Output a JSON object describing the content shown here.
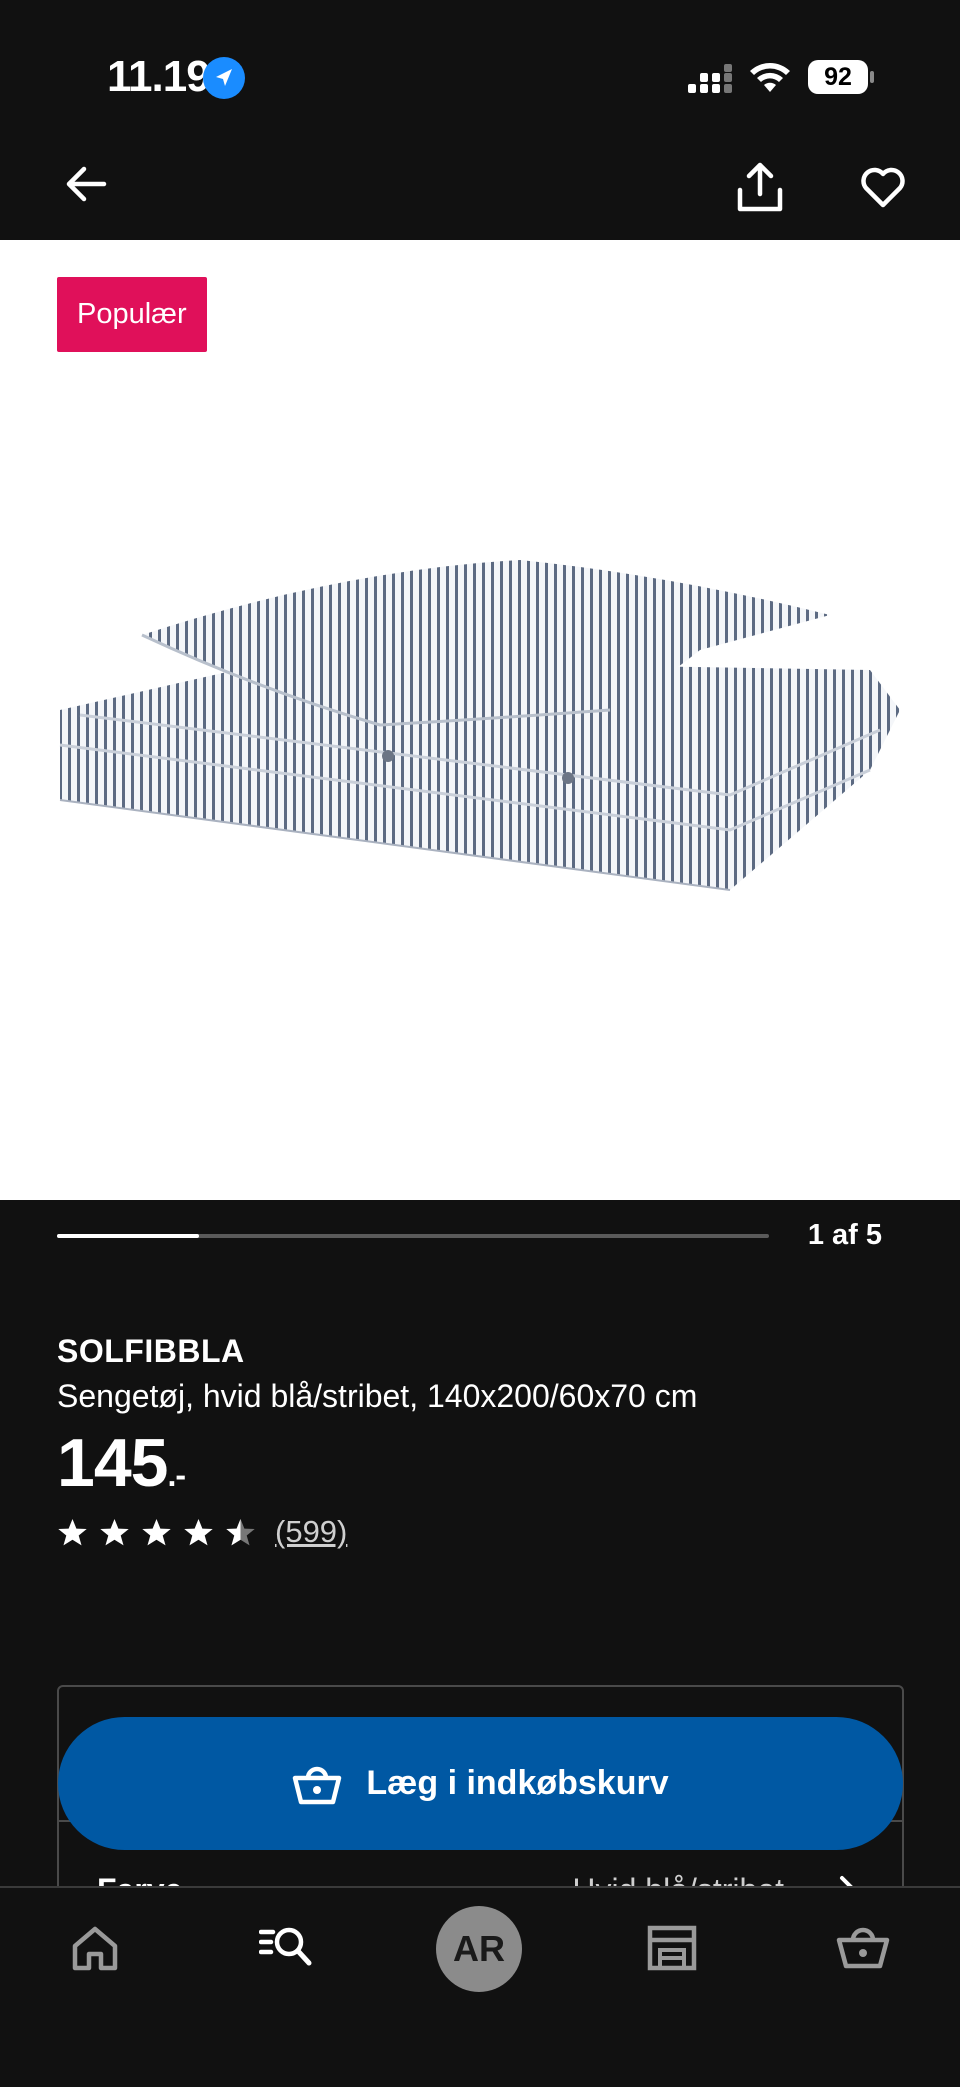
{
  "status_bar": {
    "time": "11.19",
    "battery_level": "92"
  },
  "nav": {
    "back_icon": "arrow-left-icon",
    "share_icon": "share-icon",
    "favorite_icon": "heart-icon"
  },
  "product": {
    "badge": "Populær",
    "name": "SOLFIBBLA",
    "description": "Sengetøj, hvid blå/stribet, 140x200/60x70 cm",
    "price": "145",
    "price_suffix": ".-",
    "rating": 4.5,
    "rating_max": 5,
    "review_count": "(599)"
  },
  "carousel": {
    "indicator": "1 af 5",
    "progress": 0.2
  },
  "actions": {
    "add_to_cart": "Læg i indkøbskurv"
  },
  "options": {
    "color_label": "Farve",
    "color_value": "Hvid blå/stribet"
  },
  "tab_bar": {
    "ar_label": "AR"
  },
  "colors": {
    "background": "#111111",
    "badge": "#e0105a",
    "primary_button": "#0058a3"
  }
}
